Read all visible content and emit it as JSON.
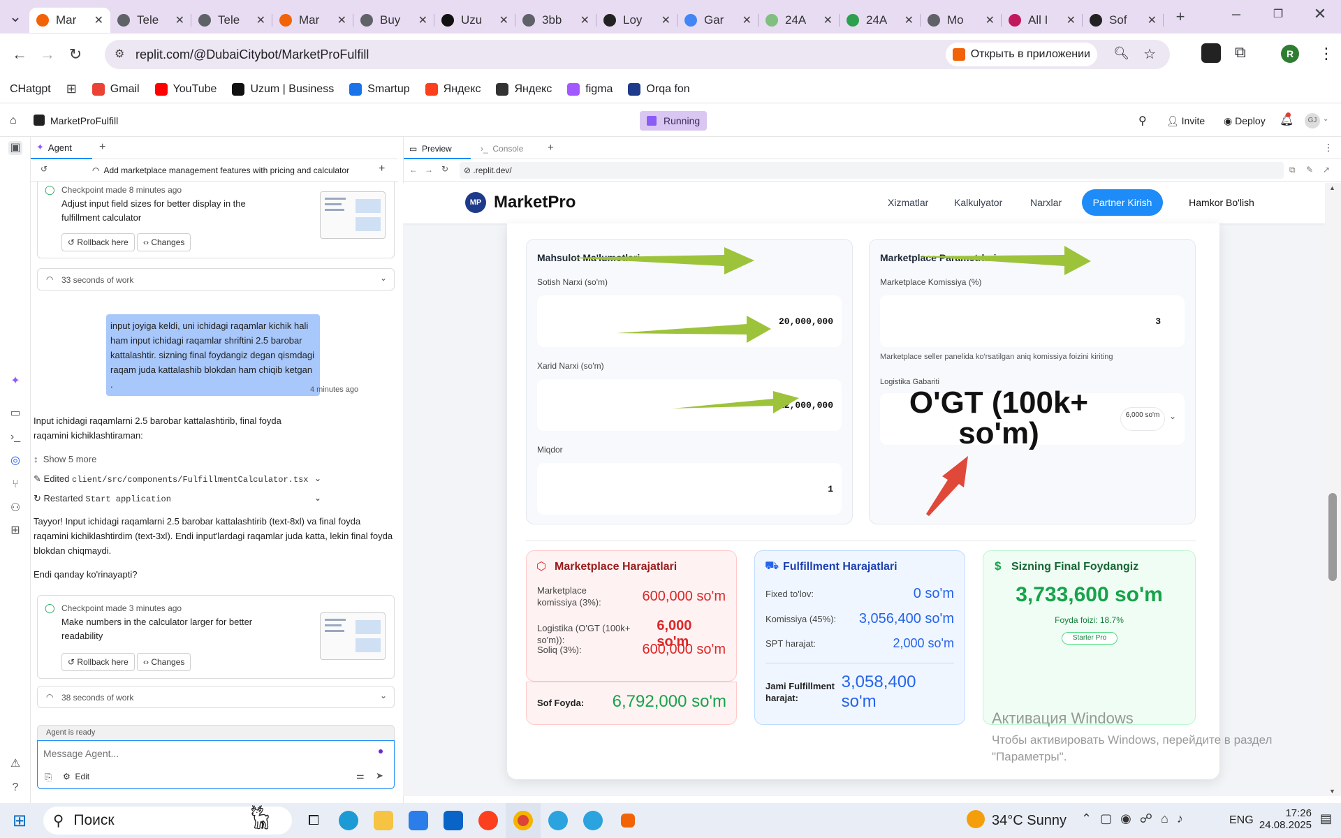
{
  "browser": {
    "tabs": [
      {
        "label": "Mar",
        "icon": "replit-icon",
        "color": "#f26207",
        "active": true
      },
      {
        "label": "Tele",
        "icon": "globe-icon",
        "color": "#5f6368"
      },
      {
        "label": "Tele",
        "icon": "globe-icon",
        "color": "#5f6368"
      },
      {
        "label": "Mar",
        "icon": "replit-icon",
        "color": "#f26207"
      },
      {
        "label": "Buy",
        "icon": "globe-icon",
        "color": "#5f6368"
      },
      {
        "label": "Uzu",
        "icon": "uzum-icon",
        "color": "#111111"
      },
      {
        "label": "3bb",
        "icon": "globe-icon",
        "color": "#5f6368"
      },
      {
        "label": "Loy",
        "icon": "openai-icon",
        "color": "#222222"
      },
      {
        "label": "Gar",
        "icon": "google-icon",
        "color": "#4285f4"
      },
      {
        "label": "24A",
        "icon": "sheet-icon",
        "color": "#7fbf7f"
      },
      {
        "label": "24A",
        "icon": "sheet-icon",
        "color": "#2e9e4f"
      },
      {
        "label": "Mo",
        "icon": "globe-icon",
        "color": "#5f6368"
      },
      {
        "label": "All I",
        "icon": "bracket-icon",
        "color": "#c2185b"
      },
      {
        "label": "Sof",
        "icon": "github-icon",
        "color": "#222222"
      }
    ],
    "url": "replit.com/@DubaiCitybot/MarketProFulfill",
    "open_in_app": "Открыть в приложении",
    "profile_letter": "R",
    "bookmarks": [
      {
        "label": "CHatgpt",
        "color": ""
      },
      {
        "label": "Gmail",
        "color": "#ea4335"
      },
      {
        "label": "YouTube",
        "color": "#ff0000"
      },
      {
        "label": "Uzum | Business",
        "color": "#111111"
      },
      {
        "label": "Smartup",
        "color": "#1a73e8"
      },
      {
        "label": "Яндекс",
        "color": "#fc3f1d"
      },
      {
        "label": "Яндекс",
        "color": "#333333"
      },
      {
        "label": "figma",
        "color": "#a259ff"
      },
      {
        "label": "Orqa fon",
        "color": "#1e3a8a"
      }
    ]
  },
  "replit": {
    "project_name": "MarketProFulfill",
    "status": "Running",
    "invite": "Invite",
    "deploy": "Deploy",
    "avatar": "GJ",
    "agent_tab": "Agent",
    "preview_tab": "Preview",
    "console_tab": "Console",
    "preview_url": ".replit.dev/"
  },
  "agent": {
    "thread_title": "Add marketplace management features with pricing and calculator",
    "checkpoint1": {
      "time": "Checkpoint made 8 minutes ago",
      "text": "Adjust input field sizes for better display in the fulfillment calculator",
      "rollback": "Rollback here",
      "changes": "Changes"
    },
    "work1": "33 seconds of work",
    "user_msg": "input joyiga keldi, uni ichidagi raqamlar kichik hali ham input ichidagi raqamlar shriftini 2.5 barobar kattalashtir. sizning final foydangiz degan qismdagi raqam juda kattalashib blokdan ham chiqib ketgan .",
    "user_time": "4 minutes ago",
    "reply_intro": "Input ichidagi raqamlarni 2.5 barobar kattalashtirib, final foyda raqamini kichiklashtiraman:",
    "show_more": "Show 5 more",
    "edited_label": "Edited",
    "edited_file": "client/src/components/FulfillmentCalculator.tsx",
    "restarted_label": "Restarted",
    "restarted_target": "Start application",
    "reply_done": "Tayyor! Input ichidagi raqamlarni 2.5 barobar kattalashtirib (text-8xl) va final foyda raqamini kichiklashtirdim (text-3xl). Endi input'lardagi raqamlar juda katta, lekin final foyda blokdan chiqmaydi.",
    "reply_question": "Endi qanday ko'rinayapti?",
    "checkpoint2": {
      "time": "Checkpoint made 3 minutes ago",
      "text": "Make numbers in the calculator larger for better readability",
      "rollback": "Rollback here",
      "changes": "Changes"
    },
    "work2": "38 seconds of work",
    "ready": "Agent is ready",
    "input_placeholder": "Message Agent...",
    "edit": "Edit"
  },
  "site": {
    "logo_badge": "MP",
    "brand": "MarketPro",
    "nav": [
      "Xizmatlar",
      "Kalkulyator",
      "Narxlar"
    ],
    "partner_btn": "Partner Kirish",
    "hamkor_btn": "Hamkor Bo'lish",
    "product": {
      "title": "Mahsulot Ma'lumotlari",
      "sell_label": "Sotish Narxi (so'm)",
      "sell_value": "20,000,000",
      "buy_label": "Xarid Narxi (so'm)",
      "buy_value": "12,000,000",
      "qty_label": "Miqdor",
      "qty_value": "1"
    },
    "marketplace": {
      "title": "Marketplace Parametrlari",
      "commission_label": "Marketplace Komissiya (%)",
      "commission_value": "3",
      "hint": "Marketplace seller panelida ko'rsatilgan aniq komissiya foizini kiriting",
      "logistics_label": "Logistika Gabariti",
      "logistics_value": "O'GT (100k+ so'm)",
      "logistics_badge": "6,000 so'm"
    },
    "mp_costs": {
      "title": "Marketplace Harajatlari",
      "rows": [
        {
          "label": "Marketplace komissiya (3%):",
          "value": "600,000 so'm"
        },
        {
          "label": "Logistika (O'GT (100k+ so'm)):",
          "value": "6,000 so'm"
        },
        {
          "label": "Soliq (3%):",
          "value": "600,000 so'm"
        }
      ],
      "total_label": "Sof Foyda:",
      "total_value": "6,792,000 so'm"
    },
    "ff_costs": {
      "title": "Fulfillment Harajatlari",
      "rows": [
        {
          "label": "Fixed to'lov:",
          "value": "0 so'm"
        },
        {
          "label": "Komissiya (45%):",
          "value": "3,056,400 so'm"
        },
        {
          "label": "SPT harajat:",
          "value": "2,000 so'm"
        }
      ],
      "total_label": "Jami Fulfillment harajat:",
      "total_value": "3,058,400 so'm"
    },
    "final": {
      "title": "Sizning Final Foydangiz",
      "value": "3,733,600 so'm",
      "percent": "Foyda foizi: 18.7%",
      "plan": "Starter Pro"
    }
  },
  "windows": {
    "activation_title": "Активация Windows",
    "activation_text1": "Чтобы активировать Windows, перейдите в раздел",
    "activation_text2": "\"Параметры\".",
    "search": "Поиск",
    "weather": "34°C Sunny",
    "lang": "ENG",
    "time": "17:26",
    "date": "24.08.2025"
  },
  "colors": {
    "accent_blue": "#1d8cf8",
    "red": "#dc2626",
    "blue": "#2563eb",
    "green": "#16a34a",
    "arrow_green": "#9dc33b",
    "arrow_red": "#e0483a"
  }
}
